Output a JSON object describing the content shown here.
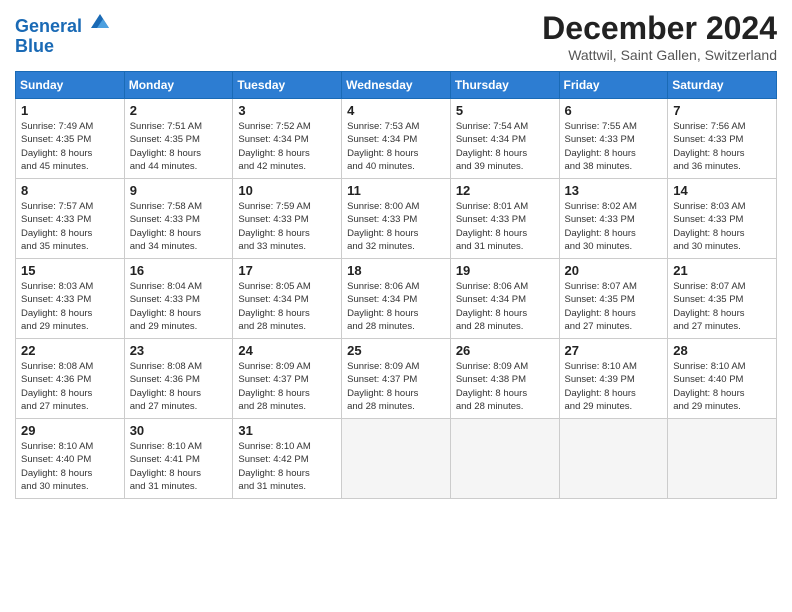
{
  "header": {
    "logo_line1": "General",
    "logo_line2": "Blue",
    "title": "December 2024",
    "subtitle": "Wattwil, Saint Gallen, Switzerland"
  },
  "weekdays": [
    "Sunday",
    "Monday",
    "Tuesday",
    "Wednesday",
    "Thursday",
    "Friday",
    "Saturday"
  ],
  "weeks": [
    [
      {
        "day": "1",
        "lines": [
          "Sunrise: 7:49 AM",
          "Sunset: 4:35 PM",
          "Daylight: 8 hours",
          "and 45 minutes."
        ]
      },
      {
        "day": "2",
        "lines": [
          "Sunrise: 7:51 AM",
          "Sunset: 4:35 PM",
          "Daylight: 8 hours",
          "and 44 minutes."
        ]
      },
      {
        "day": "3",
        "lines": [
          "Sunrise: 7:52 AM",
          "Sunset: 4:34 PM",
          "Daylight: 8 hours",
          "and 42 minutes."
        ]
      },
      {
        "day": "4",
        "lines": [
          "Sunrise: 7:53 AM",
          "Sunset: 4:34 PM",
          "Daylight: 8 hours",
          "and 40 minutes."
        ]
      },
      {
        "day": "5",
        "lines": [
          "Sunrise: 7:54 AM",
          "Sunset: 4:34 PM",
          "Daylight: 8 hours",
          "and 39 minutes."
        ]
      },
      {
        "day": "6",
        "lines": [
          "Sunrise: 7:55 AM",
          "Sunset: 4:33 PM",
          "Daylight: 8 hours",
          "and 38 minutes."
        ]
      },
      {
        "day": "7",
        "lines": [
          "Sunrise: 7:56 AM",
          "Sunset: 4:33 PM",
          "Daylight: 8 hours",
          "and 36 minutes."
        ]
      }
    ],
    [
      {
        "day": "8",
        "lines": [
          "Sunrise: 7:57 AM",
          "Sunset: 4:33 PM",
          "Daylight: 8 hours",
          "and 35 minutes."
        ]
      },
      {
        "day": "9",
        "lines": [
          "Sunrise: 7:58 AM",
          "Sunset: 4:33 PM",
          "Daylight: 8 hours",
          "and 34 minutes."
        ]
      },
      {
        "day": "10",
        "lines": [
          "Sunrise: 7:59 AM",
          "Sunset: 4:33 PM",
          "Daylight: 8 hours",
          "and 33 minutes."
        ]
      },
      {
        "day": "11",
        "lines": [
          "Sunrise: 8:00 AM",
          "Sunset: 4:33 PM",
          "Daylight: 8 hours",
          "and 32 minutes."
        ]
      },
      {
        "day": "12",
        "lines": [
          "Sunrise: 8:01 AM",
          "Sunset: 4:33 PM",
          "Daylight: 8 hours",
          "and 31 minutes."
        ]
      },
      {
        "day": "13",
        "lines": [
          "Sunrise: 8:02 AM",
          "Sunset: 4:33 PM",
          "Daylight: 8 hours",
          "and 30 minutes."
        ]
      },
      {
        "day": "14",
        "lines": [
          "Sunrise: 8:03 AM",
          "Sunset: 4:33 PM",
          "Daylight: 8 hours",
          "and 30 minutes."
        ]
      }
    ],
    [
      {
        "day": "15",
        "lines": [
          "Sunrise: 8:03 AM",
          "Sunset: 4:33 PM",
          "Daylight: 8 hours",
          "and 29 minutes."
        ]
      },
      {
        "day": "16",
        "lines": [
          "Sunrise: 8:04 AM",
          "Sunset: 4:33 PM",
          "Daylight: 8 hours",
          "and 29 minutes."
        ]
      },
      {
        "day": "17",
        "lines": [
          "Sunrise: 8:05 AM",
          "Sunset: 4:34 PM",
          "Daylight: 8 hours",
          "and 28 minutes."
        ]
      },
      {
        "day": "18",
        "lines": [
          "Sunrise: 8:06 AM",
          "Sunset: 4:34 PM",
          "Daylight: 8 hours",
          "and 28 minutes."
        ]
      },
      {
        "day": "19",
        "lines": [
          "Sunrise: 8:06 AM",
          "Sunset: 4:34 PM",
          "Daylight: 8 hours",
          "and 28 minutes."
        ]
      },
      {
        "day": "20",
        "lines": [
          "Sunrise: 8:07 AM",
          "Sunset: 4:35 PM",
          "Daylight: 8 hours",
          "and 27 minutes."
        ]
      },
      {
        "day": "21",
        "lines": [
          "Sunrise: 8:07 AM",
          "Sunset: 4:35 PM",
          "Daylight: 8 hours",
          "and 27 minutes."
        ]
      }
    ],
    [
      {
        "day": "22",
        "lines": [
          "Sunrise: 8:08 AM",
          "Sunset: 4:36 PM",
          "Daylight: 8 hours",
          "and 27 minutes."
        ]
      },
      {
        "day": "23",
        "lines": [
          "Sunrise: 8:08 AM",
          "Sunset: 4:36 PM",
          "Daylight: 8 hours",
          "and 27 minutes."
        ]
      },
      {
        "day": "24",
        "lines": [
          "Sunrise: 8:09 AM",
          "Sunset: 4:37 PM",
          "Daylight: 8 hours",
          "and 28 minutes."
        ]
      },
      {
        "day": "25",
        "lines": [
          "Sunrise: 8:09 AM",
          "Sunset: 4:37 PM",
          "Daylight: 8 hours",
          "and 28 minutes."
        ]
      },
      {
        "day": "26",
        "lines": [
          "Sunrise: 8:09 AM",
          "Sunset: 4:38 PM",
          "Daylight: 8 hours",
          "and 28 minutes."
        ]
      },
      {
        "day": "27",
        "lines": [
          "Sunrise: 8:10 AM",
          "Sunset: 4:39 PM",
          "Daylight: 8 hours",
          "and 29 minutes."
        ]
      },
      {
        "day": "28",
        "lines": [
          "Sunrise: 8:10 AM",
          "Sunset: 4:40 PM",
          "Daylight: 8 hours",
          "and 29 minutes."
        ]
      }
    ],
    [
      {
        "day": "29",
        "lines": [
          "Sunrise: 8:10 AM",
          "Sunset: 4:40 PM",
          "Daylight: 8 hours",
          "and 30 minutes."
        ]
      },
      {
        "day": "30",
        "lines": [
          "Sunrise: 8:10 AM",
          "Sunset: 4:41 PM",
          "Daylight: 8 hours",
          "and 31 minutes."
        ]
      },
      {
        "day": "31",
        "lines": [
          "Sunrise: 8:10 AM",
          "Sunset: 4:42 PM",
          "Daylight: 8 hours",
          "and 31 minutes."
        ]
      },
      {
        "day": "",
        "lines": []
      },
      {
        "day": "",
        "lines": []
      },
      {
        "day": "",
        "lines": []
      },
      {
        "day": "",
        "lines": []
      }
    ]
  ]
}
